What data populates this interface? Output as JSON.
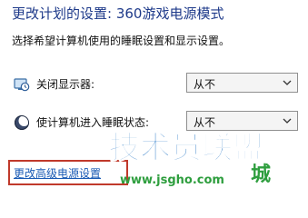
{
  "page": {
    "title": "更改计划的设置: 360游戏电源模式",
    "subtitle": "选择希望计算机使用的睡眠设置和显示设置。"
  },
  "settings": [
    {
      "label": "关闭显示器:",
      "icon": "monitor-clock-icon",
      "value": "从不"
    },
    {
      "label": "使计算机进入睡眠状态:",
      "icon": "sleep-moon-icon",
      "value": "从不"
    }
  ],
  "links": {
    "advanced": "更改高级电源设置"
  },
  "watermark": {
    "brand": "技术员联盟",
    "url": "www.jsgho.com",
    "suffix": "城"
  },
  "colors": {
    "title": "#1e3a8a",
    "link": "#1a5bb5",
    "highlight_border": "#c0392b",
    "watermark_blue": "#1b6fc2",
    "watermark_green": "#2e9e3e"
  }
}
